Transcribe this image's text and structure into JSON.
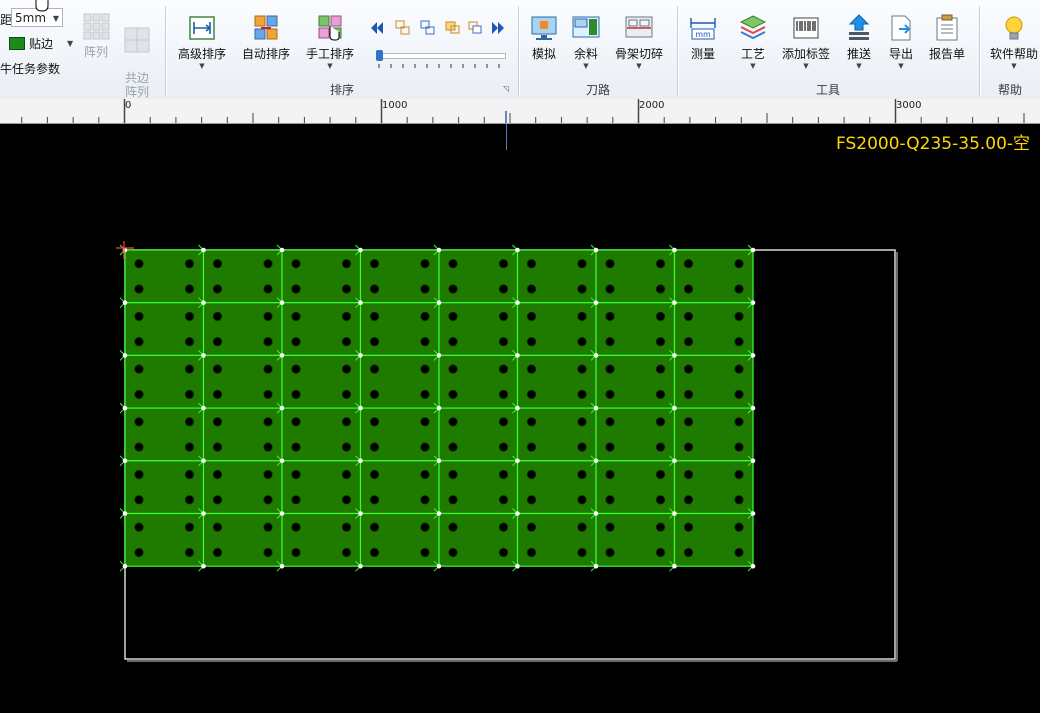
{
  "ribbon": {
    "left": {
      "spacing_label": "距",
      "spacing_value": "5mm",
      "edge_label": "贴边",
      "task_params_label": "牛任务参数",
      "array_label": "阵列",
      "common_edge_array_label": "共边\n阵列"
    },
    "sort_group": {
      "label": "排序",
      "advanced_sort": "高级排序",
      "auto_sort": "自动排序",
      "manual_sort": "手工排序"
    },
    "path_group": {
      "label": "刀路",
      "simulate": "模拟",
      "remnant": "余料",
      "skeleton_cut": "骨架切碎"
    },
    "tools_group": {
      "label": "工具",
      "measure": "测量",
      "process": "工艺",
      "add_label": "添加标签",
      "push": "推送",
      "export": "导出",
      "report": "报告单"
    },
    "help_group": {
      "label": "帮助",
      "software_help": "软件帮助"
    }
  },
  "ruler": {
    "labels": [
      "0",
      "1000",
      "2000",
      "3000"
    ]
  },
  "canvas": {
    "sheet_title": "FS2000-Q235-35.00-空"
  },
  "colors": {
    "part_fill": "#1f7a00",
    "part_edge": "#33ff33",
    "sheet_border": "#d8d8d8",
    "title": "#ffd800"
  },
  "parts": {
    "columns": 8,
    "rows": 6,
    "holes_per_part": 4
  }
}
